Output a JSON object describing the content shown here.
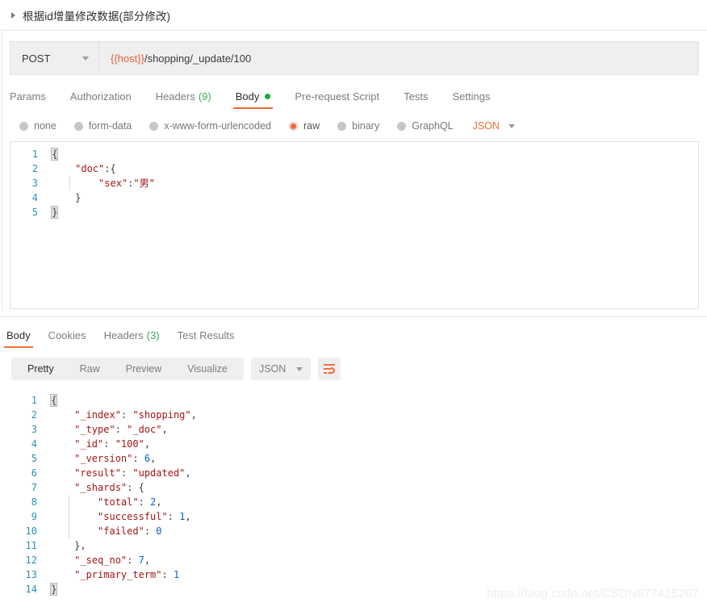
{
  "request_header": {
    "title": "根据id增量修改数据(部分修改)",
    "disclosure_icon": "triangle-right-icon"
  },
  "url_bar": {
    "method": "POST",
    "url_variable": "{{host}}",
    "url_path": "/shopping/_update/100",
    "method_caret_icon": "chevron-down-icon"
  },
  "request_tabs": [
    {
      "label": "Params",
      "count": "",
      "active": false
    },
    {
      "label": "Authorization",
      "count": "",
      "active": false
    },
    {
      "label": "Headers",
      "count": "(9)",
      "active": false
    },
    {
      "label": "Body",
      "count": "",
      "active": true
    },
    {
      "label": "Pre-request Script",
      "count": "",
      "active": false
    },
    {
      "label": "Tests",
      "count": "",
      "active": false
    },
    {
      "label": "Settings",
      "count": "",
      "active": false
    }
  ],
  "body_types": [
    {
      "label": "none",
      "selected": false
    },
    {
      "label": "form-data",
      "selected": false
    },
    {
      "label": "x-www-form-urlencoded",
      "selected": false
    },
    {
      "label": "raw",
      "selected": true
    },
    {
      "label": "binary",
      "selected": false
    },
    {
      "label": "GraphQL",
      "selected": false
    }
  ],
  "body_format": {
    "value": "JSON",
    "caret_icon": "chevron-down-icon"
  },
  "request_body": {
    "line_numbers": [
      "1",
      "2",
      "3",
      "4",
      "5"
    ],
    "lines": [
      {
        "indent": 0,
        "tokens": [
          {
            "t": "{",
            "c": "brace-hl"
          }
        ]
      },
      {
        "indent": 1,
        "tokens": [
          {
            "t": "\"doc\"",
            "c": "k-key"
          },
          {
            "t": ":{",
            "c": "k-punct"
          }
        ]
      },
      {
        "indent": 2,
        "tokens": [
          {
            "t": "\"sex\"",
            "c": "k-key"
          },
          {
            "t": ":",
            "c": "k-punct"
          },
          {
            "t": "\"男\"",
            "c": "k-str"
          }
        ]
      },
      {
        "indent": 1,
        "tokens": [
          {
            "t": "}",
            "c": "k-punct"
          }
        ]
      },
      {
        "indent": 0,
        "tokens": [
          {
            "t": "}",
            "c": "brace-hl"
          }
        ]
      }
    ]
  },
  "response_tabs": [
    {
      "label": "Body",
      "count": "",
      "active": true
    },
    {
      "label": "Cookies",
      "count": "",
      "active": false
    },
    {
      "label": "Headers",
      "count": "(3)",
      "active": false
    },
    {
      "label": "Test Results",
      "count": "",
      "active": false
    }
  ],
  "response_toolbar": {
    "view_modes": [
      {
        "label": "Pretty",
        "active": true
      },
      {
        "label": "Raw",
        "active": false
      },
      {
        "label": "Preview",
        "active": false
      },
      {
        "label": "Visualize",
        "active": false
      }
    ],
    "format": {
      "value": "JSON",
      "caret_icon": "chevron-down-icon"
    },
    "wrap_button_icon": "wrap-text-icon"
  },
  "response_body": {
    "line_numbers": [
      "1",
      "2",
      "3",
      "4",
      "5",
      "6",
      "7",
      "8",
      "9",
      "10",
      "11",
      "12",
      "13",
      "14"
    ],
    "lines": [
      {
        "indent": 0,
        "tokens": [
          {
            "t": "{",
            "c": "brace-hl"
          }
        ]
      },
      {
        "indent": 1,
        "tokens": [
          {
            "t": "\"_index\"",
            "c": "k-key"
          },
          {
            "t": ": ",
            "c": "k-punct"
          },
          {
            "t": "\"shopping\"",
            "c": "k-str"
          },
          {
            "t": ",",
            "c": "k-punct"
          }
        ]
      },
      {
        "indent": 1,
        "tokens": [
          {
            "t": "\"_type\"",
            "c": "k-key"
          },
          {
            "t": ": ",
            "c": "k-punct"
          },
          {
            "t": "\"_doc\"",
            "c": "k-str"
          },
          {
            "t": ",",
            "c": "k-punct"
          }
        ]
      },
      {
        "indent": 1,
        "tokens": [
          {
            "t": "\"_id\"",
            "c": "k-key"
          },
          {
            "t": ": ",
            "c": "k-punct"
          },
          {
            "t": "\"100\"",
            "c": "k-str"
          },
          {
            "t": ",",
            "c": "k-punct"
          }
        ]
      },
      {
        "indent": 1,
        "tokens": [
          {
            "t": "\"_version\"",
            "c": "k-key"
          },
          {
            "t": ": ",
            "c": "k-punct"
          },
          {
            "t": "6",
            "c": "k-num"
          },
          {
            "t": ",",
            "c": "k-punct"
          }
        ]
      },
      {
        "indent": 1,
        "tokens": [
          {
            "t": "\"result\"",
            "c": "k-key"
          },
          {
            "t": ": ",
            "c": "k-punct"
          },
          {
            "t": "\"updated\"",
            "c": "k-str"
          },
          {
            "t": ",",
            "c": "k-punct"
          }
        ]
      },
      {
        "indent": 1,
        "tokens": [
          {
            "t": "\"_shards\"",
            "c": "k-key"
          },
          {
            "t": ": {",
            "c": "k-punct"
          }
        ]
      },
      {
        "indent": 2,
        "tokens": [
          {
            "t": "\"total\"",
            "c": "k-key"
          },
          {
            "t": ": ",
            "c": "k-punct"
          },
          {
            "t": "2",
            "c": "k-num"
          },
          {
            "t": ",",
            "c": "k-punct"
          }
        ]
      },
      {
        "indent": 2,
        "tokens": [
          {
            "t": "\"successful\"",
            "c": "k-key"
          },
          {
            "t": ": ",
            "c": "k-punct"
          },
          {
            "t": "1",
            "c": "k-num"
          },
          {
            "t": ",",
            "c": "k-punct"
          }
        ]
      },
      {
        "indent": 2,
        "tokens": [
          {
            "t": "\"failed\"",
            "c": "k-key"
          },
          {
            "t": ": ",
            "c": "k-punct"
          },
          {
            "t": "0",
            "c": "k-num"
          }
        ]
      },
      {
        "indent": 1,
        "tokens": [
          {
            "t": "},",
            "c": "k-punct"
          }
        ]
      },
      {
        "indent": 1,
        "tokens": [
          {
            "t": "\"_seq_no\"",
            "c": "k-key"
          },
          {
            "t": ": ",
            "c": "k-punct"
          },
          {
            "t": "7",
            "c": "k-num"
          },
          {
            "t": ",",
            "c": "k-punct"
          }
        ]
      },
      {
        "indent": 1,
        "tokens": [
          {
            "t": "\"_primary_term\"",
            "c": "k-key"
          },
          {
            "t": ": ",
            "c": "k-punct"
          },
          {
            "t": "1",
            "c": "k-num"
          }
        ]
      },
      {
        "indent": 0,
        "tokens": [
          {
            "t": "}",
            "c": "brace-hl"
          }
        ]
      }
    ]
  },
  "watermark": {
    "text": "https://blog.csdn.net/CSDN877425287"
  },
  "colors": {
    "accent_orange": "#f26b35",
    "green": "#1bab38",
    "line_number": "#2b91af",
    "key_red": "#a31515",
    "number_blue": "#0a61c9"
  }
}
